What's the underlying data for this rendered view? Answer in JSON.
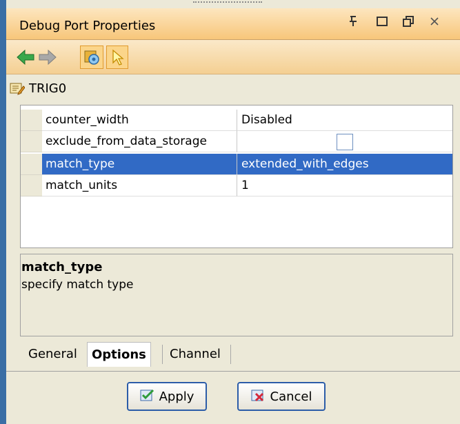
{
  "window": {
    "title": "Debug Port Properties",
    "controls": {
      "pin": "pin-icon",
      "maximize": "maximize-icon",
      "restore": "restore-icon",
      "close": "close-icon"
    }
  },
  "toolbar": {
    "back": "back-arrow-icon",
    "forward": "forward-arrow-icon",
    "settings": "gear-settings-icon",
    "select": "pointer-icon"
  },
  "object": {
    "name": "TRIG0"
  },
  "properties": [
    {
      "name": "counter_width",
      "value": "Disabled"
    },
    {
      "name": "exclude_from_data_storage",
      "value": ""
    },
    {
      "name": "match_type",
      "value": "extended_with_edges"
    },
    {
      "name": "match_units",
      "value": "1"
    }
  ],
  "description": {
    "title": "match_type",
    "text": "specify match type"
  },
  "tabs": [
    {
      "label": "General"
    },
    {
      "label": "Options"
    },
    {
      "label": "Channel"
    }
  ],
  "buttons": {
    "apply": "Apply",
    "cancel": "Cancel"
  },
  "colors": {
    "selection": "#316ac5",
    "titlebar": "#f7c67a"
  }
}
